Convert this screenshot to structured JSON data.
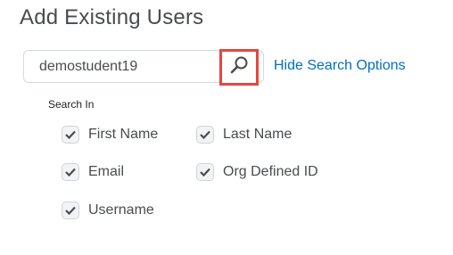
{
  "page": {
    "title": "Add Existing Users"
  },
  "search": {
    "value": "demostudent19",
    "toggle_label": "Hide Search Options"
  },
  "search_in": {
    "label": "Search In",
    "options": [
      {
        "label": "First Name",
        "checked": true
      },
      {
        "label": "Last Name",
        "checked": true
      },
      {
        "label": "Email",
        "checked": true
      },
      {
        "label": "Org Defined ID",
        "checked": true
      },
      {
        "label": "Username",
        "checked": true
      }
    ]
  },
  "colors": {
    "link": "#006fbf",
    "highlight": "#e8453c",
    "text": "#494c4e"
  }
}
